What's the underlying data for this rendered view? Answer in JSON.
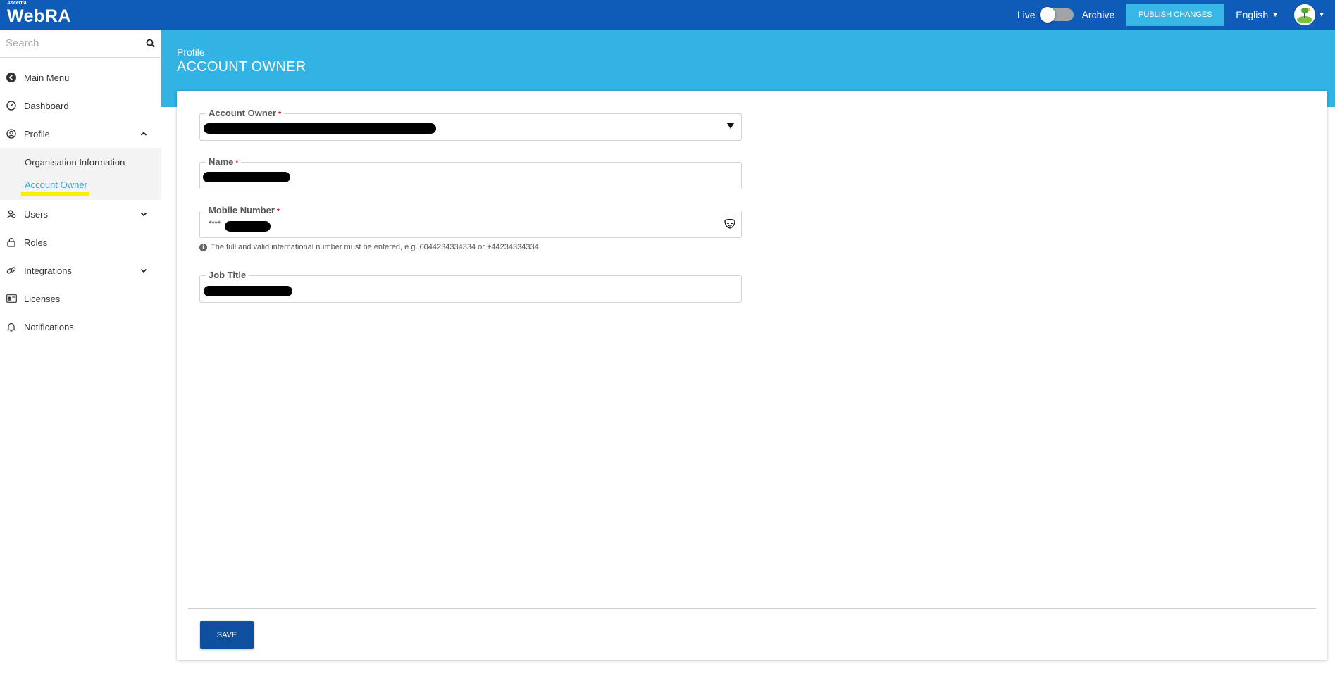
{
  "topbar": {
    "brand_small": "Ascertia",
    "brand": "WebRA",
    "live_label": "Live",
    "archive_label": "Archive",
    "publish_label": "PUBLISH CHANGES",
    "language": "English",
    "live_toggle_on": false
  },
  "sidebar": {
    "search_placeholder": "Search",
    "items": [
      {
        "label": "Main Menu",
        "icon": "back-circle-icon"
      },
      {
        "label": "Dashboard",
        "icon": "dashboard-gauge-icon"
      },
      {
        "label": "Profile",
        "icon": "user-circle-icon",
        "expanded": true
      },
      {
        "label": "Users",
        "icon": "users-icon"
      },
      {
        "label": "Roles",
        "icon": "lock-icon"
      },
      {
        "label": "Integrations",
        "icon": "link-icon"
      },
      {
        "label": "Licenses",
        "icon": "id-card-icon"
      },
      {
        "label": "Notifications",
        "icon": "bell-icon"
      }
    ],
    "profile_subitems": [
      {
        "label": "Organisation Information"
      },
      {
        "label": "Account Owner",
        "active": true
      }
    ]
  },
  "page": {
    "breadcrumb": "Profile",
    "title": "ACCOUNT OWNER"
  },
  "form": {
    "account_owner_label": "Account Owner",
    "name_label": "Name",
    "mobile_label": "Mobile Number",
    "mobile_value_prefix": "****",
    "mobile_hint": "The full and valid international number must be entered, e.g. 0044234334334 or +44234334334",
    "job_title_label": "Job Title",
    "required_mark": "*",
    "save_label": "SAVE"
  },
  "colors": {
    "topbar": "#0f5bb8",
    "header_band": "#33b2e4",
    "publish_button": "#38b6e6",
    "save_button": "#0e4fa0",
    "active_link": "#29a8e0",
    "highlight": "#f4f000"
  }
}
